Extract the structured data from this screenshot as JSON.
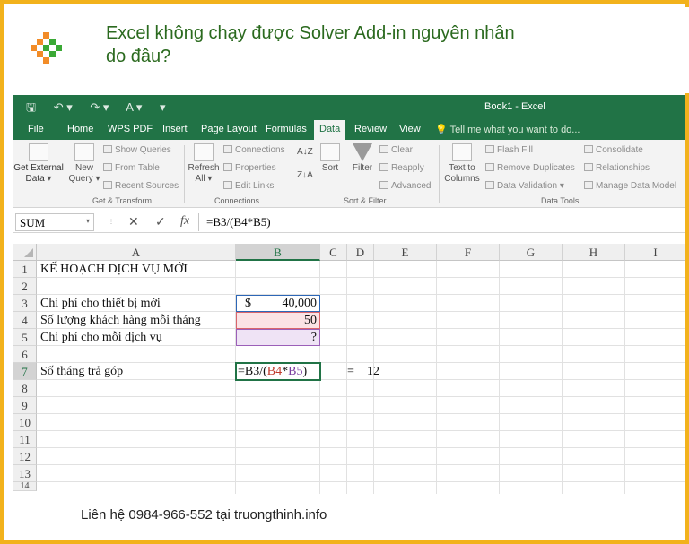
{
  "header": {
    "title": "Excel không chạy được Solver Add-in nguyên nhân do đâu?",
    "logo_colors": [
      "#f28c28",
      "#3aa935"
    ]
  },
  "footer": {
    "text": "Liên hệ 0984-966-552 tại truongthinh.info"
  },
  "excel": {
    "window_title": "Book1 - Excel",
    "qat": [
      "save-icon",
      "undo-icon",
      "redo-icon",
      "font-color-icon",
      "customize-icon"
    ],
    "tabs": [
      "File",
      "Home",
      "WPS PDF",
      "Insert",
      "Page Layout",
      "Formulas",
      "Data",
      "Review",
      "View"
    ],
    "active_tab": "Data",
    "tell_me": "Tell me what you want to do...",
    "ribbon": {
      "get_external_data": "Get External",
      "get_external_data_2": "Data",
      "new_query": "New",
      "new_query_2": "Query",
      "show_queries": "Show Queries",
      "from_table": "From Table",
      "recent_sources": "Recent Sources",
      "group_get_transform": "Get & Transform",
      "refresh": "Refresh",
      "refresh_2": "All",
      "connections": "Connections",
      "properties": "Properties",
      "edit_links": "Edit Links",
      "group_connections": "Connections",
      "sort": "Sort",
      "filter": "Filter",
      "clear": "Clear",
      "reapply": "Reapply",
      "advanced": "Advanced",
      "group_sort_filter": "Sort & Filter",
      "text_to_columns": "Text to",
      "text_to_columns_2": "Columns",
      "flash_fill": "Flash Fill",
      "remove_duplicates": "Remove Duplicates",
      "data_validation": "Data Validation",
      "consolidate": "Consolidate",
      "relationships": "Relationships",
      "manage_data_model": "Manage Data Model",
      "group_data_tools": "Data Tools"
    },
    "formula_bar": {
      "name_box": "SUM",
      "cancel": "✕",
      "enter": "✓",
      "fx": "fx",
      "formula": "=B3/(B4*B5)"
    },
    "columns": [
      "A",
      "B",
      "C",
      "D",
      "E",
      "F",
      "G",
      "H",
      "I"
    ],
    "rows": [
      "1",
      "2",
      "3",
      "4",
      "5",
      "6",
      "7",
      "8",
      "9",
      "10",
      "11",
      "12",
      "13",
      "14"
    ],
    "cells": {
      "A1": "KẾ HOẠCH DỊCH VỤ MỚI",
      "A3": "Chi phí cho thiết bị mới",
      "A4": "Số lượng khách hàng mỗi tháng",
      "A5": "Chi phí cho mỗi dịch vụ",
      "A7": "Số tháng trả góp",
      "B3_currency": "$",
      "B3": "40,000",
      "B4": "50",
      "B5": "?",
      "B7_p1": "=B3/(",
      "B7_p2": "B4",
      "B7_p3": "*",
      "B7_p4": "B5",
      "B7_p5": ")",
      "C7": "=",
      "D7": "12"
    }
  }
}
